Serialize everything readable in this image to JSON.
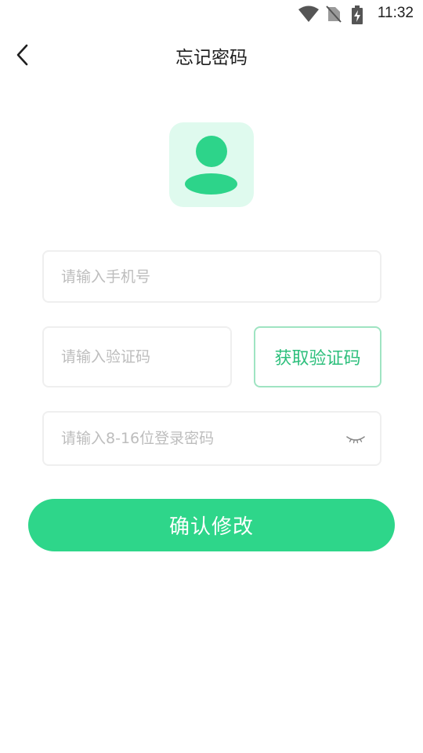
{
  "status_bar": {
    "time": "11:32",
    "icons": [
      "wifi-icon",
      "no-sim-icon",
      "battery-charging-icon"
    ]
  },
  "header": {
    "title": "忘记密码",
    "back_icon": "chevron-left-icon"
  },
  "avatar": {
    "icon": "user-avatar-icon"
  },
  "form": {
    "phone": {
      "placeholder": "请输入手机号",
      "value": ""
    },
    "code": {
      "placeholder": "请输入验证码",
      "value": ""
    },
    "get_code_label": "获取验证码",
    "password": {
      "placeholder": "请输入8-16位登录密码",
      "value": "",
      "toggle_icon": "eye-closed-icon"
    },
    "confirm_label": "确认修改"
  },
  "colors": {
    "accent": "#2ed68a",
    "accent_light_bg": "#dffaee",
    "accent_border": "#9fe4c2",
    "accent_text": "#2dbf7c",
    "placeholder": "#bdbdbd",
    "field_border": "#efefef"
  }
}
